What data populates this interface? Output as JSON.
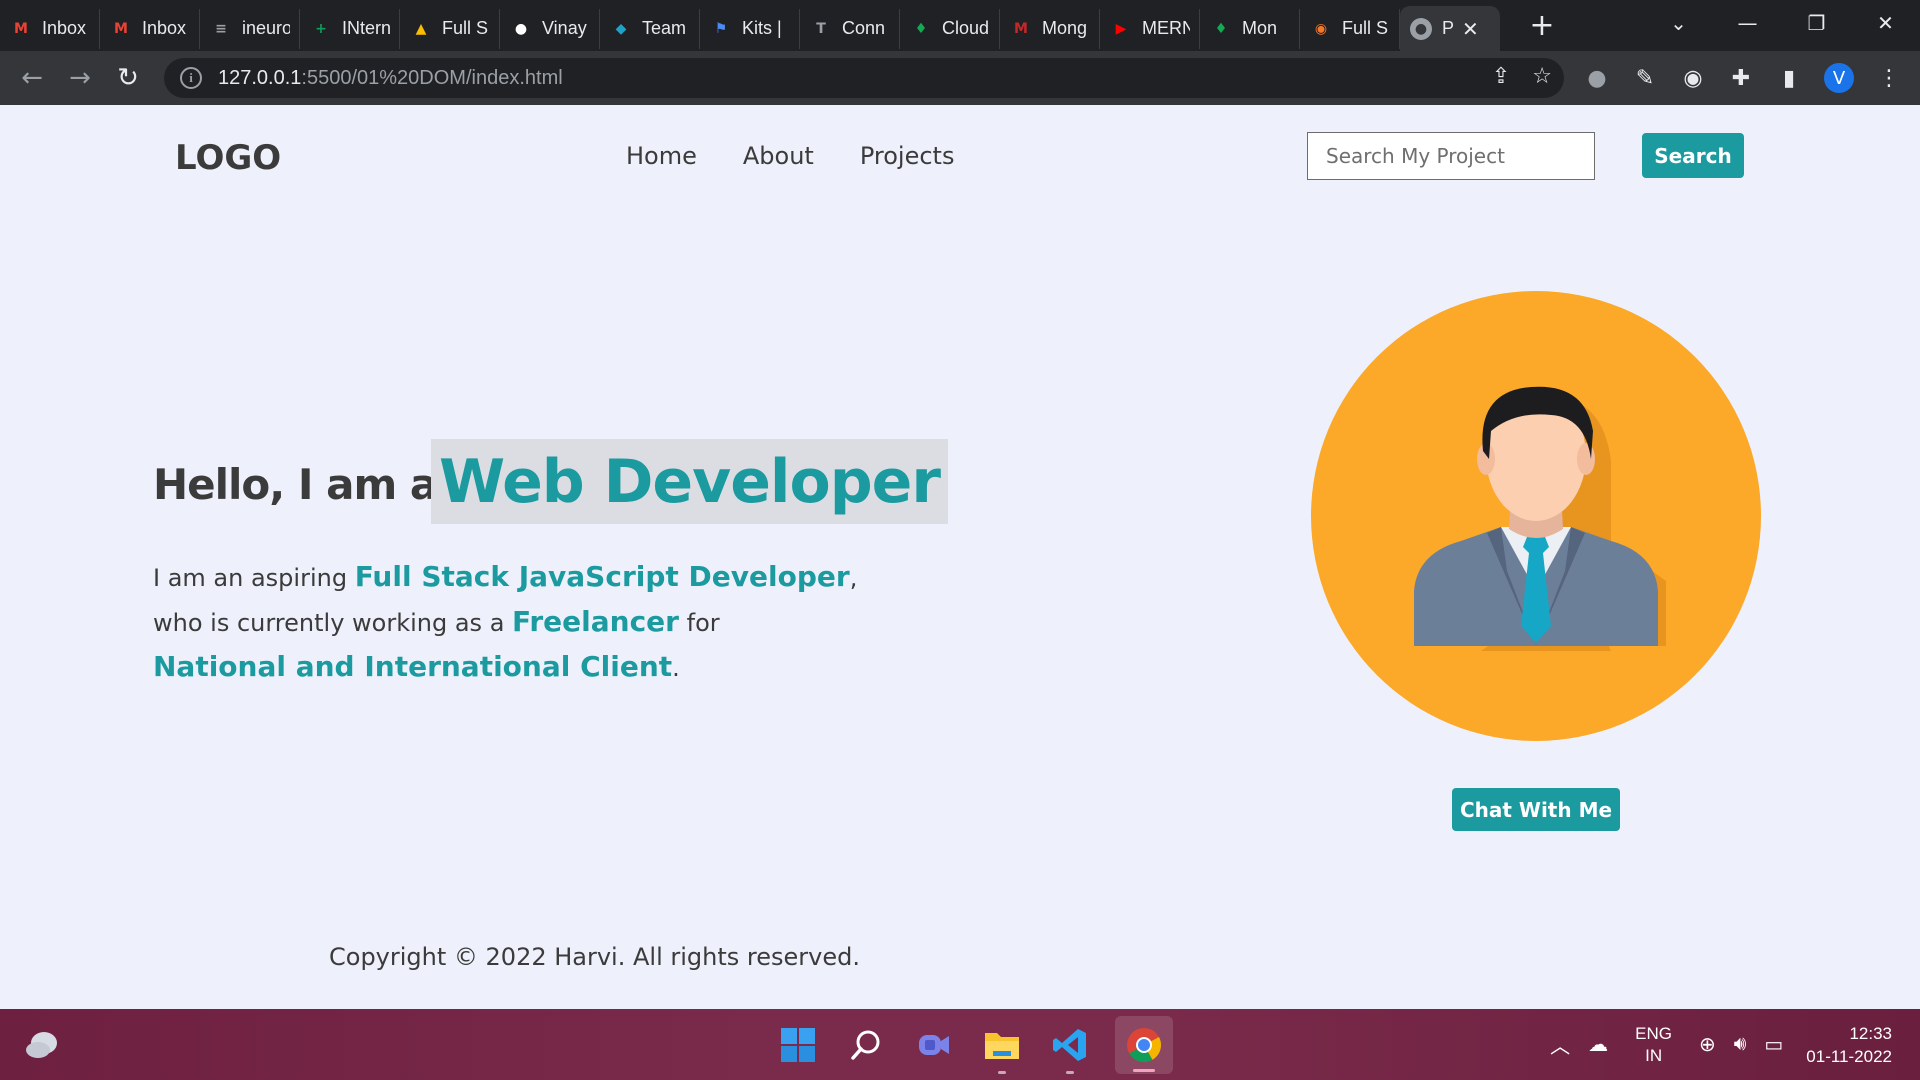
{
  "browser": {
    "tabs": [
      {
        "label": "Inbox",
        "icon": "gmail-icon",
        "color": "#ea4335",
        "glyph": "M"
      },
      {
        "label": "Inbox",
        "icon": "gmail-icon",
        "color": "#ea4335",
        "glyph": "M"
      },
      {
        "label": "ineuron",
        "icon": "ineuron-icon",
        "color": "#9aa0a6",
        "glyph": "≡"
      },
      {
        "label": "INtern",
        "icon": "sheets-icon",
        "color": "#0f9d58",
        "glyph": "+"
      },
      {
        "label": "Full S",
        "icon": "drive-icon",
        "color": "#fbbc04",
        "glyph": "▲"
      },
      {
        "label": "Vinay",
        "icon": "github-icon",
        "color": "#ffffff",
        "glyph": "●"
      },
      {
        "label": "Team",
        "icon": "team-icon",
        "color": "#1fa2c9",
        "glyph": "◆"
      },
      {
        "label": "Kits |",
        "icon": "flag-icon",
        "color": "#4c8bf5",
        "glyph": "⚑"
      },
      {
        "label": "Conn",
        "icon": "conn-icon",
        "color": "#9aa0a6",
        "glyph": "T"
      },
      {
        "label": "Cloud",
        "icon": "mongodb-icon",
        "color": "#13aa52",
        "glyph": "♦"
      },
      {
        "label": "Mong",
        "icon": "mongo-m-icon",
        "color": "#c62828",
        "glyph": "M"
      },
      {
        "label": "MERN",
        "icon": "youtube-icon",
        "color": "#ff0000",
        "glyph": "▶"
      },
      {
        "label": "Mon",
        "icon": "mongodb-icon",
        "color": "#13aa52",
        "glyph": "♦"
      },
      {
        "label": "Full S",
        "icon": "jupyter-icon",
        "color": "#f37726",
        "glyph": "◉"
      }
    ],
    "active_tab": {
      "label": "P",
      "icon": "globe-icon"
    },
    "url_host": "127.0.0.1",
    "url_path": ":5500/01%20DOM/index.html",
    "profile_initial": "V"
  },
  "site": {
    "logo": "LOGO",
    "nav": [
      "Home",
      "About",
      "Projects"
    ],
    "search_placeholder": "Search My Project",
    "search_button": "Search",
    "hello": "Hello, I am a",
    "role": "Web Developer",
    "bio": {
      "p1": "I am an aspiring ",
      "h1": "Full Stack JavaScript Developer",
      "p2": ",",
      "p3": "who is currently working as a ",
      "h2": "Freelancer",
      "p4": " for",
      "h3": "National and International Client",
      "p5": "."
    },
    "chat_button": "Chat With Me",
    "copyright": "Copyright © 2022 Harvi. All rights reserved.",
    "colors": {
      "accent": "#1b9aa0",
      "portrait_bg": "#fca829",
      "text": "#3b3b3b",
      "page_bg": "#eef1fb"
    }
  },
  "taskbar": {
    "lang_top": "ENG",
    "lang_bottom": "IN",
    "time": "12:33",
    "date": "01-11-2022"
  }
}
